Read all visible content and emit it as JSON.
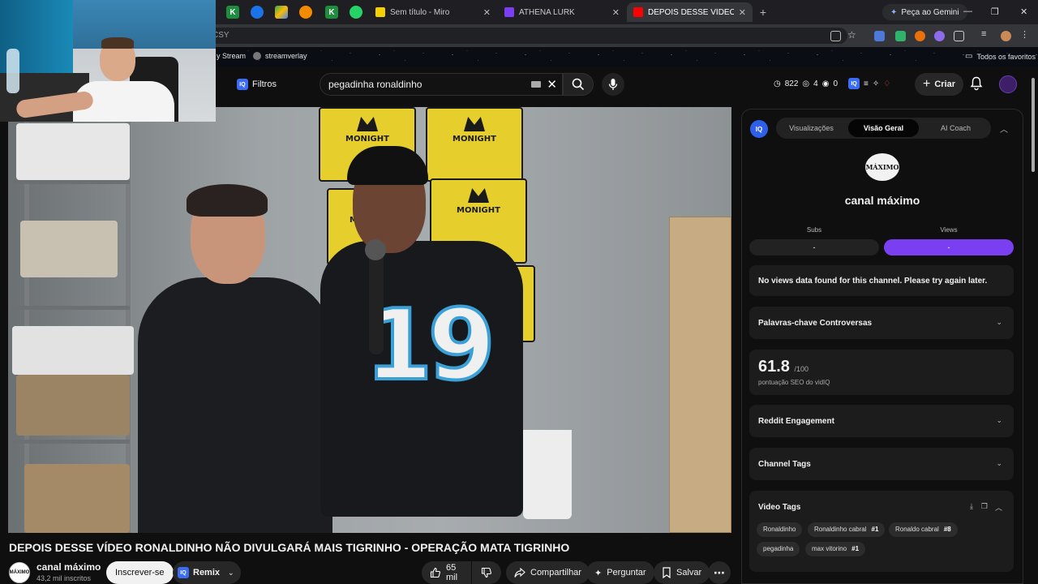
{
  "browser": {
    "tabs": [
      {
        "label": "Sem título - Miro",
        "color": "#f5d000"
      },
      {
        "label": "ATHENA LURK",
        "color": "#7a3ff2"
      },
      {
        "label": "DEPOIS DESSE VÍDEO RON...",
        "color": "#ff0000"
      }
    ],
    "pinned_tab_letters": [
      "K",
      "K"
    ],
    "gemini_label": "Peça ao Gemini",
    "address_fragment": "CSY",
    "bookmarks": [
      "y Stream",
      "streamverlay"
    ],
    "all_bookmarks": "Todos os favoritos"
  },
  "youtube": {
    "filters_label": "Filtros",
    "search_query": "pegadinha ronaldinho",
    "stats": {
      "clock": "822",
      "views": "4",
      "subs": "0"
    },
    "create_label": "Criar"
  },
  "video": {
    "title": "DEPOIS DESSE VÍDEO RONALDINHO NÃO DIVULGARÁ MAIS TIGRINHO - OPERAÇÃO MATA TIGRINHO",
    "channel_name": "canal máximo",
    "channel_subs": "43,2 mil inscritos",
    "channel_avatar_text": "MÁXIMO",
    "subscribe_label": "Inscrever-se",
    "remix_label": "Remix",
    "likes": "65 mil",
    "share_label": "Compartilhar",
    "ask_label": "Perguntar",
    "save_label": "Salvar",
    "bag_text": "MONIGHT",
    "jersey_number": "19"
  },
  "vidiq": {
    "tabs": [
      "Visualizações",
      "Visão Geral",
      "AI Coach"
    ],
    "active_tab": "Visão Geral",
    "logo_text": "MÁXIMO",
    "channel_name": "canal máximo",
    "subs_label": "Subs",
    "views_label": "Views",
    "subs_value": "-",
    "views_value": "-",
    "no_data_msg": "No views data found for this channel. Please try again later.",
    "controversial_label": "Palavras-chave Controversas",
    "seo_score": "61.8",
    "seo_max": "/100",
    "seo_label": "pontuação SEO do vidIQ",
    "reddit_label": "Reddit Engagement",
    "channel_tags_label": "Channel Tags",
    "video_tags_label": "Video Tags",
    "video_tags": [
      {
        "tag": "Ronaldinho",
        "rank": ""
      },
      {
        "tag": "Ronaldinho cabral",
        "rank": "#1"
      },
      {
        "tag": "Ronaldo cabral",
        "rank": "#8"
      },
      {
        "tag": "pegadinha",
        "rank": ""
      },
      {
        "tag": "max vitorino",
        "rank": "#1"
      }
    ],
    "accent": "#7b3ff2"
  }
}
